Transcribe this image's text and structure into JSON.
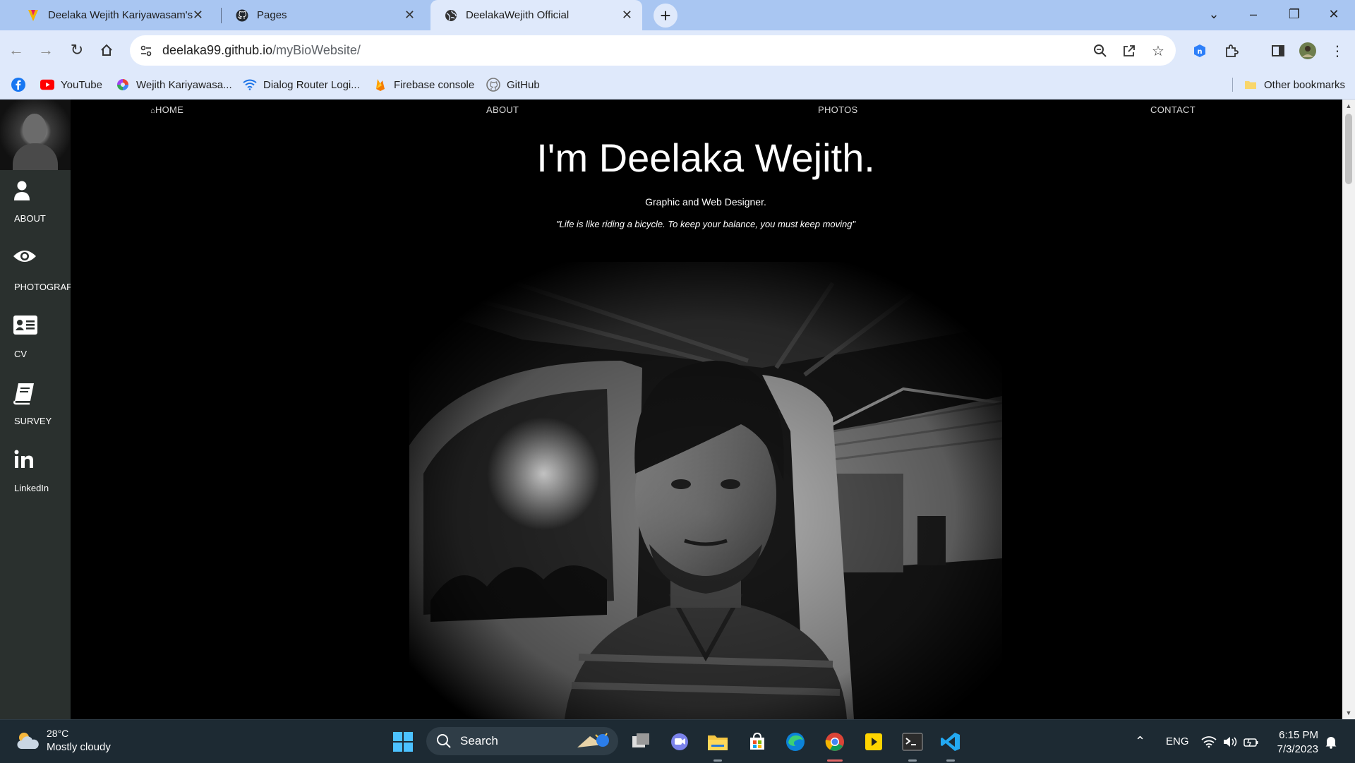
{
  "browser": {
    "tabs": [
      {
        "title": "Deelaka Wejith Kariyawasam's F",
        "active": false
      },
      {
        "title": "Pages",
        "active": false
      },
      {
        "title": "DeelakaWejith Official",
        "active": true
      }
    ],
    "url_host": "deelaka99.github.io",
    "url_path": "/myBioWebsite/",
    "bookmarks": [
      {
        "label": "YouTube",
        "icon": "youtube-icon"
      },
      {
        "label": "Wejith Kariyawasa...",
        "icon": "colorful-swirl-icon"
      },
      {
        "label": "Dialog Router Logi...",
        "icon": "wifi-icon"
      },
      {
        "label": "Firebase console",
        "icon": "firebase-icon"
      },
      {
        "label": "GitHub",
        "icon": "github-icon"
      }
    ],
    "other_bookmarks": "Other bookmarks"
  },
  "site": {
    "nav": {
      "home": "HOME",
      "about": "ABOUT",
      "photos": "PHOTOS",
      "contact": "CONTACT"
    },
    "sidebar": [
      {
        "label": "ABOUT",
        "icon": "user-icon"
      },
      {
        "label": "PHOTOGRAPHY",
        "icon": "eye-icon"
      },
      {
        "label": "CV",
        "icon": "id-card-icon"
      },
      {
        "label": "SURVEY",
        "icon": "book-icon"
      },
      {
        "label": "LinkedIn",
        "icon": "linkedin-icon"
      }
    ],
    "hero": {
      "title": "I'm Deelaka Wejith.",
      "subtitle": "Graphic and Web Designer.",
      "quote": "\"Life is like riding a bicycle. To keep your balance, you must keep moving\""
    }
  },
  "taskbar": {
    "weather_temp": "28°C",
    "weather_desc": "Mostly cloudy",
    "search_label": "Search",
    "language": "ENG",
    "time": "6:15 PM",
    "date": "7/3/2023"
  },
  "colors": {
    "tab_strip": "#a9c6f2",
    "toolbar": "#dfe9fb",
    "sidebar": "#2a302e",
    "page_bg": "#000000",
    "taskbar": "#1d2a33"
  }
}
